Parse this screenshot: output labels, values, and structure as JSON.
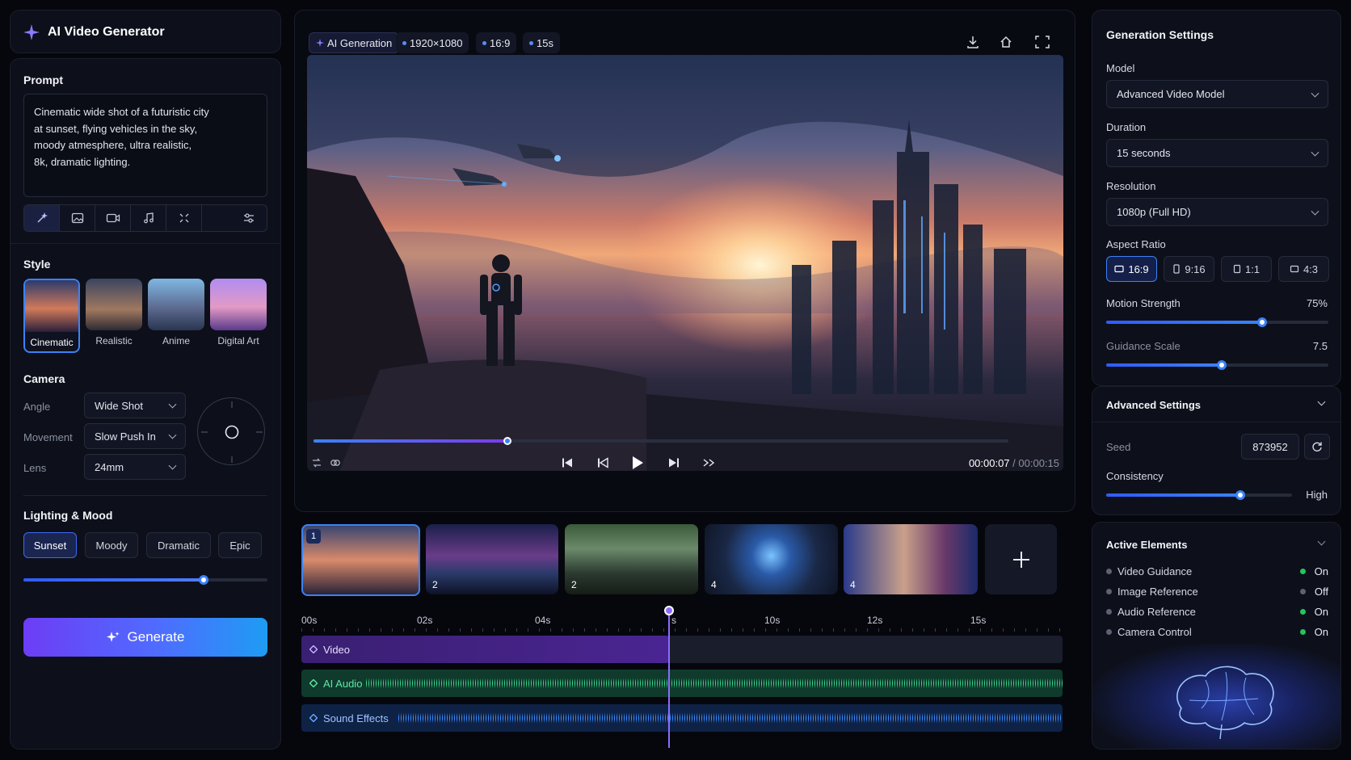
{
  "app": {
    "title": "AI Video Generator"
  },
  "prompt": {
    "label": "Prompt",
    "text_lines": [
      "Cinematic wide shot of a futuristic city",
      "at sunset, flying vehicles in the sky,",
      "moody atmesphere, ultra realistic,",
      "8k, dramatic lighting."
    ]
  },
  "style": {
    "label": "Style",
    "options": [
      "Cinematic",
      "Realistic",
      "Anime",
      "Digital Art"
    ],
    "selected": "Cinematic"
  },
  "camera": {
    "label": "Camera",
    "fields": [
      {
        "label": "Angle",
        "value": "Wide Shot"
      },
      {
        "label": "Movement",
        "value": "Slow Push In"
      },
      {
        "label": "Lens",
        "value": "24mm"
      }
    ]
  },
  "lighting": {
    "label": "Lighting & Mood",
    "options": [
      "Sunset",
      "Moody",
      "Dramatic",
      "Epic"
    ],
    "selected": "Sunset",
    "intensity": 0.74
  },
  "generate": {
    "label": "Generate"
  },
  "preview": {
    "chips": [
      "AI Generation",
      "1920×1080",
      "16:9",
      "15s"
    ],
    "current_time": "00:00:07",
    "separator": " / ",
    "total_time": "00:00:15",
    "progress": 0.28
  },
  "scenes": [
    {
      "badge": "1"
    },
    {
      "badge": "2"
    },
    {
      "badge": "2"
    },
    {
      "badge": "4"
    },
    {
      "badge": "4"
    }
  ],
  "timeline": {
    "ticks": [
      "00s",
      "02s",
      "04s",
      "s",
      "10s",
      "12s",
      "15s"
    ],
    "tracks": [
      "Video",
      "AI Audio",
      "Sound Effects"
    ]
  },
  "settings": {
    "title": "Generation Settings",
    "model": {
      "label": "Model",
      "value": "Advanced Video Model"
    },
    "duration": {
      "label": "Duration",
      "value": "15 seconds"
    },
    "resolution": {
      "label": "Resolution",
      "value": "1080p (Full HD)"
    },
    "aspect": {
      "label": "Aspect Ratio",
      "options": [
        "16:9",
        "9:16",
        "1:1",
        "4:3"
      ],
      "selected": "16:9"
    },
    "motion": {
      "label": "Motion Strength",
      "value": "75%",
      "fraction": 0.7
    },
    "guidance": {
      "label": "Guidance Scale",
      "value": "7.5",
      "fraction": 0.52
    }
  },
  "advanced": {
    "title": "Advanced Settings",
    "seed": {
      "label": "Seed",
      "value": "873952"
    },
    "consistency": {
      "label": "Consistency",
      "value": "High",
      "fraction": 0.72
    }
  },
  "active": {
    "title": "Active Elements",
    "items": [
      {
        "label": "Video Guidance",
        "state": "On"
      },
      {
        "label": "Image Reference",
        "state": "Off"
      },
      {
        "label": "Audio Reference",
        "state": "On"
      },
      {
        "label": "Camera Control",
        "state": "On"
      }
    ]
  },
  "colors": {
    "accent": "#3b82f6",
    "purple": "#7c3aed",
    "green": "#22c55e",
    "bg": "#06070d"
  }
}
